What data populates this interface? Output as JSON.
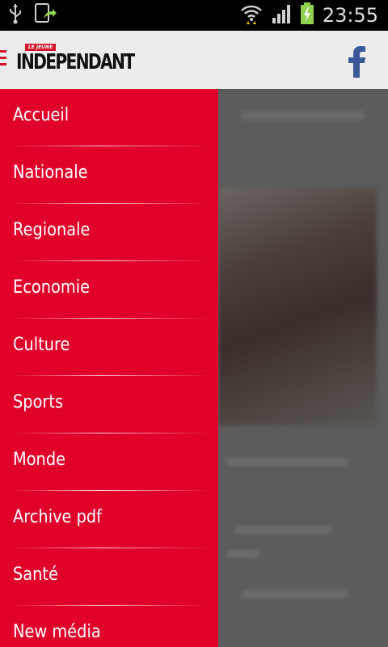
{
  "status_bar": {
    "time": "23:55",
    "icons": [
      "usb-icon",
      "screenshot-share-icon",
      "wifi-icon",
      "signal-icon",
      "battery-charging-icon"
    ]
  },
  "action_bar": {
    "logo_small_text": "LE JEUNE",
    "logo_text": "INDEPENDANT",
    "menu_icon": "hamburger-icon",
    "facebook_icon": "facebook-icon"
  },
  "drawer": {
    "items": [
      {
        "label": "Accueil"
      },
      {
        "label": "Nationale"
      },
      {
        "label": "Regionale"
      },
      {
        "label": "Economie"
      },
      {
        "label": "Culture"
      },
      {
        "label": "Sports"
      },
      {
        "label": "Monde"
      },
      {
        "label": "Archive pdf"
      },
      {
        "label": "Santé"
      },
      {
        "label": "New média"
      }
    ]
  },
  "colors": {
    "drawer_bg": "#e0002a",
    "accent": "#d4112b",
    "facebook": "#3b5998",
    "action_bar_bg": "#ececec"
  }
}
